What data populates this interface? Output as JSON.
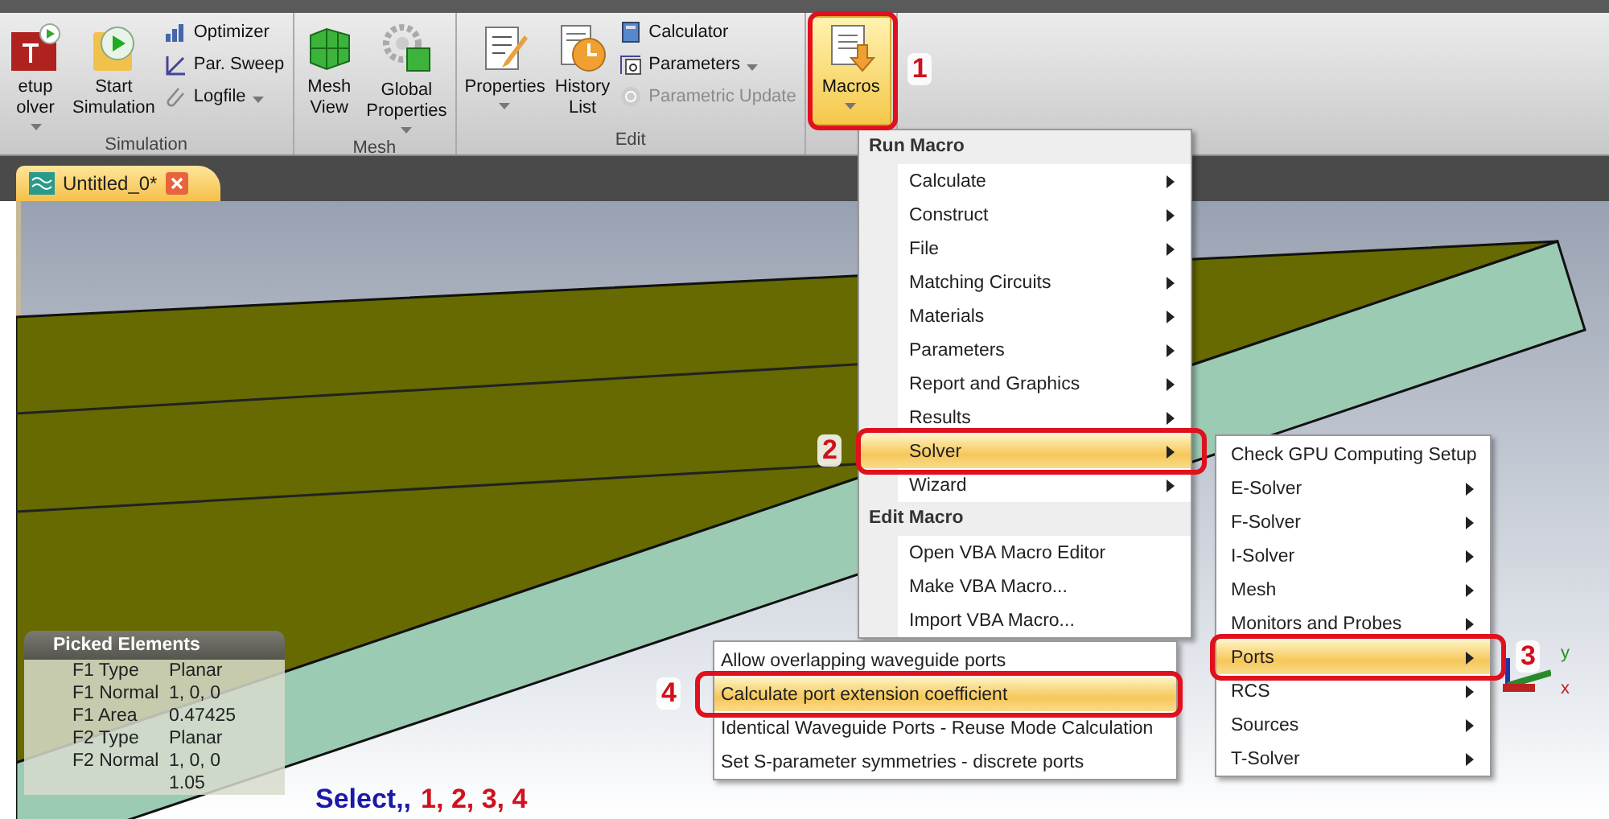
{
  "ribbon": {
    "groups": [
      {
        "label": "Simulation",
        "items": [
          {
            "kind": "large",
            "lines": [
              "etup",
              "olver"
            ],
            "dropdown": true,
            "selected": false
          },
          {
            "kind": "large",
            "lines": [
              "Start",
              "Simulation"
            ],
            "dropdown": false,
            "selected": false
          },
          {
            "kind": "stack",
            "entries": [
              {
                "label": "Optimizer",
                "dropdown": false,
                "disabled": false
              },
              {
                "label": "Par. Sweep",
                "dropdown": false,
                "disabled": false
              },
              {
                "label": "Logfile",
                "dropdown": true,
                "disabled": false
              }
            ]
          }
        ]
      },
      {
        "label": "Mesh",
        "items": [
          {
            "kind": "large",
            "lines": [
              "Mesh",
              "View"
            ],
            "dropdown": false,
            "selected": false
          },
          {
            "kind": "large",
            "lines": [
              "Global",
              "Properties"
            ],
            "dropdown": true,
            "selected": false
          }
        ]
      },
      {
        "label": "Edit",
        "items": [
          {
            "kind": "large",
            "lines": [
              "Properties"
            ],
            "dropdown": true,
            "selected": false
          },
          {
            "kind": "large",
            "lines": [
              "History",
              "List"
            ],
            "dropdown": false,
            "selected": false
          },
          {
            "kind": "stack",
            "entries": [
              {
                "label": "Calculator",
                "dropdown": false,
                "disabled": false
              },
              {
                "label": "Parameters",
                "dropdown": true,
                "disabled": false
              },
              {
                "label": "Parametric Update",
                "dropdown": false,
                "disabled": true
              }
            ]
          }
        ]
      },
      {
        "items": [
          {
            "kind": "large",
            "lines": [
              "Macros"
            ],
            "dropdown": true,
            "selected": true
          }
        ]
      }
    ]
  },
  "tabs": [
    {
      "label": "Untitled_0*",
      "selected": true
    }
  ],
  "menu": {
    "items": [
      {
        "kind": "header",
        "label": "Run Macro"
      },
      {
        "kind": "item",
        "label": "Calculate",
        "submenu": true,
        "selected": false
      },
      {
        "kind": "item",
        "label": "Construct",
        "submenu": true,
        "selected": false
      },
      {
        "kind": "item",
        "label": "File",
        "submenu": true,
        "selected": false
      },
      {
        "kind": "item",
        "label": "Matching Circuits",
        "submenu": true,
        "selected": false
      },
      {
        "kind": "item",
        "label": "Materials",
        "submenu": true,
        "selected": false
      },
      {
        "kind": "item",
        "label": "Parameters",
        "submenu": true,
        "selected": false
      },
      {
        "kind": "item",
        "label": "Report and Graphics",
        "submenu": true,
        "selected": false
      },
      {
        "kind": "item",
        "label": "Results",
        "submenu": true,
        "selected": false
      },
      {
        "kind": "item",
        "label": "Solver",
        "submenu": true,
        "selected": true,
        "children": [
          {
            "label": "Check GPU Computing Setup",
            "submenu": false,
            "selected": false
          },
          {
            "label": "E-Solver",
            "submenu": true,
            "selected": false
          },
          {
            "label": "F-Solver",
            "submenu": true,
            "selected": false
          },
          {
            "label": "I-Solver",
            "submenu": true,
            "selected": false
          },
          {
            "label": "Mesh",
            "submenu": true,
            "selected": false
          },
          {
            "label": "Monitors and Probes",
            "submenu": true,
            "selected": false
          },
          {
            "label": "Ports",
            "submenu": true,
            "selected": true,
            "children": [
              {
                "label": "Allow overlapping waveguide ports",
                "submenu": false,
                "selected": false
              },
              {
                "label": "Calculate port extension coefficient",
                "submenu": false,
                "selected": true
              },
              {
                "label": "Identical Waveguide Ports - Reuse Mode Calculation",
                "submenu": false,
                "selected": false
              },
              {
                "label": "Set S-parameter symmetries - discrete ports",
                "submenu": false,
                "selected": false
              }
            ]
          },
          {
            "label": "RCS",
            "submenu": true,
            "selected": false
          },
          {
            "label": "Sources",
            "submenu": true,
            "selected": false
          },
          {
            "label": "T-Solver",
            "submenu": true,
            "selected": false
          }
        ]
      },
      {
        "kind": "item",
        "label": "Wizard",
        "submenu": true,
        "selected": false
      },
      {
        "kind": "header",
        "label": "Edit Macro"
      },
      {
        "kind": "item",
        "label": "Open VBA Macro Editor",
        "submenu": false,
        "selected": false
      },
      {
        "kind": "item",
        "label": "Make VBA Macro...",
        "submenu": false,
        "selected": false
      },
      {
        "kind": "item",
        "label": "Import VBA Macro...",
        "submenu": false,
        "selected": false
      }
    ]
  },
  "picked_elements": {
    "title": "Picked Elements",
    "rows": [
      {
        "label": "F1 Type",
        "value": "Planar"
      },
      {
        "label": "F1 Normal",
        "value": "1, 0, 0"
      },
      {
        "label": "F1 Area",
        "value": "0.47425"
      },
      {
        "label": "F2 Type",
        "value": "Planar"
      },
      {
        "label": "F2 Normal",
        "value": "1, 0, 0"
      },
      {
        "value": "1.05"
      }
    ]
  },
  "axes": {
    "x": "x",
    "y": "y"
  },
  "annotations": [
    {
      "number": "1"
    },
    {
      "number": "2"
    },
    {
      "number": "3"
    },
    {
      "number": "4"
    }
  ],
  "caption": {
    "prefix": "Select,,",
    "steps": "1, 2, 3, 4"
  }
}
